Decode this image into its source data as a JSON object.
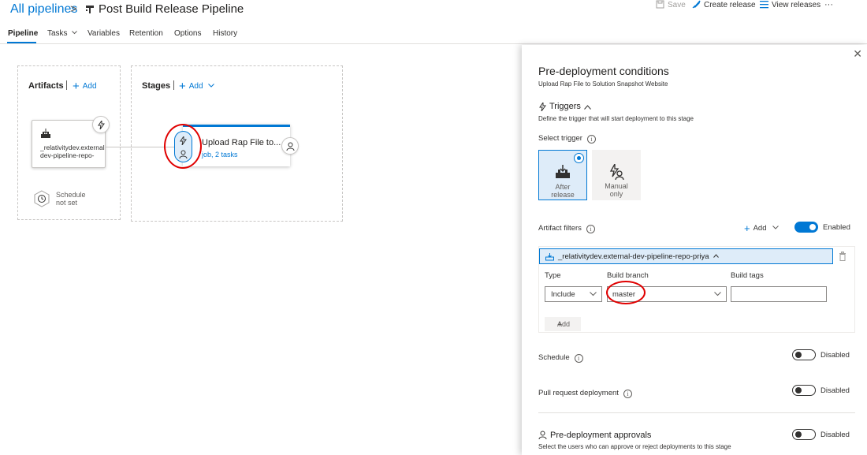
{
  "header": {
    "breadcrumb_link": "All pipelines",
    "breadcrumb_sep": ">",
    "pipeline_title": "Post Build Release Pipeline",
    "actions": {
      "save": "Save",
      "create_release": "Create release",
      "view_releases": "View releases",
      "more": "···"
    }
  },
  "tabs": [
    "Pipeline",
    "Tasks",
    "Variables",
    "Retention",
    "Options",
    "History"
  ],
  "canvas": {
    "artifacts": {
      "title": "Artifacts",
      "add_label": "Add",
      "artifact_name": "_relativitydev.external-dev-pipeline-repo-priya",
      "schedule_line1": "Schedule",
      "schedule_line2": "not set"
    },
    "stages": {
      "title": "Stages",
      "add_label": "Add",
      "stage_name": "Upload Rap File to...",
      "stage_sub": "job, 2 tasks"
    }
  },
  "panel": {
    "close": "✕",
    "title": "Pre-deployment conditions",
    "subtitle": "Upload Rap File to Solution Snapshot Website",
    "triggers": {
      "heading": "Triggers",
      "description": "Define the trigger that will start deployment to this stage",
      "select_label": "Select trigger",
      "options": [
        {
          "line1": "After",
          "line2": "release",
          "selected": true
        },
        {
          "line1": "Manual",
          "line2": "only",
          "selected": false
        }
      ]
    },
    "artifact_filters": {
      "label": "Artifact filters",
      "add_label": "Add",
      "toggle_state": "Enabled",
      "artifact": "_relativitydev.external-dev-pipeline-repo-priya",
      "columns": {
        "type": "Type",
        "branch": "Build branch",
        "tags": "Build tags"
      },
      "row": {
        "type": "Include",
        "branch": "master",
        "tags": ""
      },
      "add_row_label": "Add"
    },
    "schedule": {
      "label": "Schedule",
      "state": "Disabled"
    },
    "pull_request": {
      "label": "Pull request deployment",
      "state": "Disabled"
    },
    "approvals": {
      "heading": "Pre-deployment approvals",
      "description": "Select the users who can approve or reject deployments to this stage",
      "state": "Disabled"
    }
  },
  "colors": {
    "accent": "#0078d4",
    "highlight_ring": "#e00000",
    "selected_bg": "#deecf9"
  }
}
